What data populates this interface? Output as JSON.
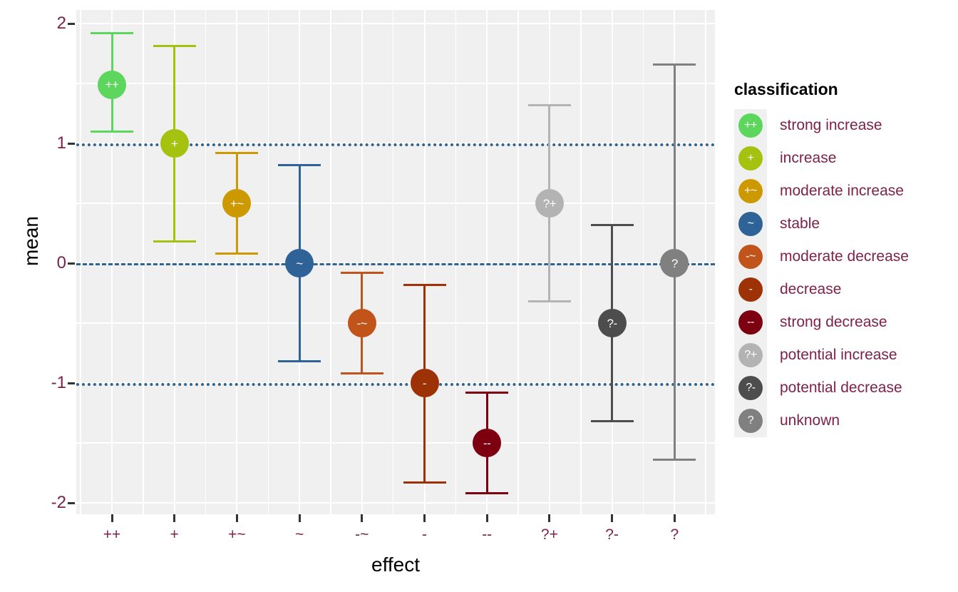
{
  "chart_data": {
    "type": "scatter",
    "title": "",
    "xlabel": "effect",
    "ylabel": "mean",
    "ylim": [
      -2.13,
      2.13
    ],
    "yticks": [
      2,
      1,
      0,
      -1,
      -2
    ],
    "ytick_labels": [
      "2",
      "1",
      "0",
      "-1",
      "-2"
    ],
    "categories": [
      "++",
      "+",
      "+~",
      "~",
      "-~",
      "-",
      "--",
      "?+",
      "?-",
      "?"
    ],
    "legend_position": "right",
    "grid": true,
    "error_bar_type": "range",
    "reference_lines": [
      {
        "y": 1,
        "style": "dotted",
        "color": "#30638e"
      },
      {
        "y": 0,
        "style": "dashed",
        "color": "#30638e"
      },
      {
        "y": -1,
        "style": "dotted",
        "color": "#30638e"
      }
    ],
    "points": [
      {
        "effect": "++",
        "classification": "strong increase",
        "label": "++",
        "mean": 1.49,
        "lower": 1.1,
        "upper": 1.92,
        "color": "#5cd65c"
      },
      {
        "effect": "+",
        "classification": "increase",
        "label": "+",
        "mean": 1.0,
        "lower": 0.18,
        "upper": 1.81,
        "color": "#a5c211"
      },
      {
        "effect": "+~",
        "classification": "moderate increase",
        "label": "+~",
        "mean": 0.5,
        "lower": 0.08,
        "upper": 0.92,
        "color": "#cc9900"
      },
      {
        "effect": "~",
        "classification": "stable",
        "label": "~",
        "mean": 0.0,
        "lower": -0.82,
        "upper": 0.82,
        "color": "#2f6296"
      },
      {
        "effect": "-~",
        "classification": "moderate decrease",
        "label": "-~",
        "mean": -0.5,
        "lower": -0.92,
        "upper": -0.08,
        "color": "#c1541a"
      },
      {
        "effect": "-",
        "classification": "decrease",
        "label": "-",
        "mean": -1.0,
        "lower": -1.83,
        "upper": -0.18,
        "color": "#9c3206"
      },
      {
        "effect": "--",
        "classification": "strong decrease",
        "label": "--",
        "mean": -1.5,
        "lower": -1.92,
        "upper": -1.08,
        "color": "#7d0011"
      },
      {
        "effect": "?+",
        "classification": "potential increase",
        "label": "?+",
        "mean": 0.5,
        "lower": -0.32,
        "upper": 1.32,
        "color": "#b3b3b3"
      },
      {
        "effect": "?-",
        "classification": "potential decrease",
        "label": "?-",
        "mean": -0.5,
        "lower": -1.32,
        "upper": 0.32,
        "color": "#4d4d4d"
      },
      {
        "effect": "?",
        "classification": "unknown",
        "label": "?",
        "mean": 0.0,
        "lower": -1.64,
        "upper": 1.66,
        "color": "#808080"
      }
    ]
  },
  "legend": {
    "title": "classification",
    "items": [
      {
        "label": "strong increase",
        "glyph": "++",
        "color": "#5cd65c"
      },
      {
        "label": "increase",
        "glyph": "+",
        "color": "#a5c211"
      },
      {
        "label": "moderate increase",
        "glyph": "+~",
        "color": "#cc9900"
      },
      {
        "label": "stable",
        "glyph": "~",
        "color": "#2f6296"
      },
      {
        "label": "moderate decrease",
        "glyph": "-~",
        "color": "#c1541a"
      },
      {
        "label": "decrease",
        "glyph": "-",
        "color": "#9c3206"
      },
      {
        "label": "strong decrease",
        "glyph": "--",
        "color": "#7d0011"
      },
      {
        "label": "potential increase",
        "glyph": "?+",
        "color": "#b3b3b3"
      },
      {
        "label": "potential decrease",
        "glyph": "?-",
        "color": "#4d4d4d"
      },
      {
        "label": "unknown",
        "glyph": "?",
        "color": "#808080"
      }
    ]
  },
  "theme": {
    "panel_background": "#f0f0f0",
    "grid_color": "#ffffff",
    "axis_text_color": "#7d2248",
    "axis_title_color": "#000000",
    "reference_line_color": "#30638e"
  }
}
